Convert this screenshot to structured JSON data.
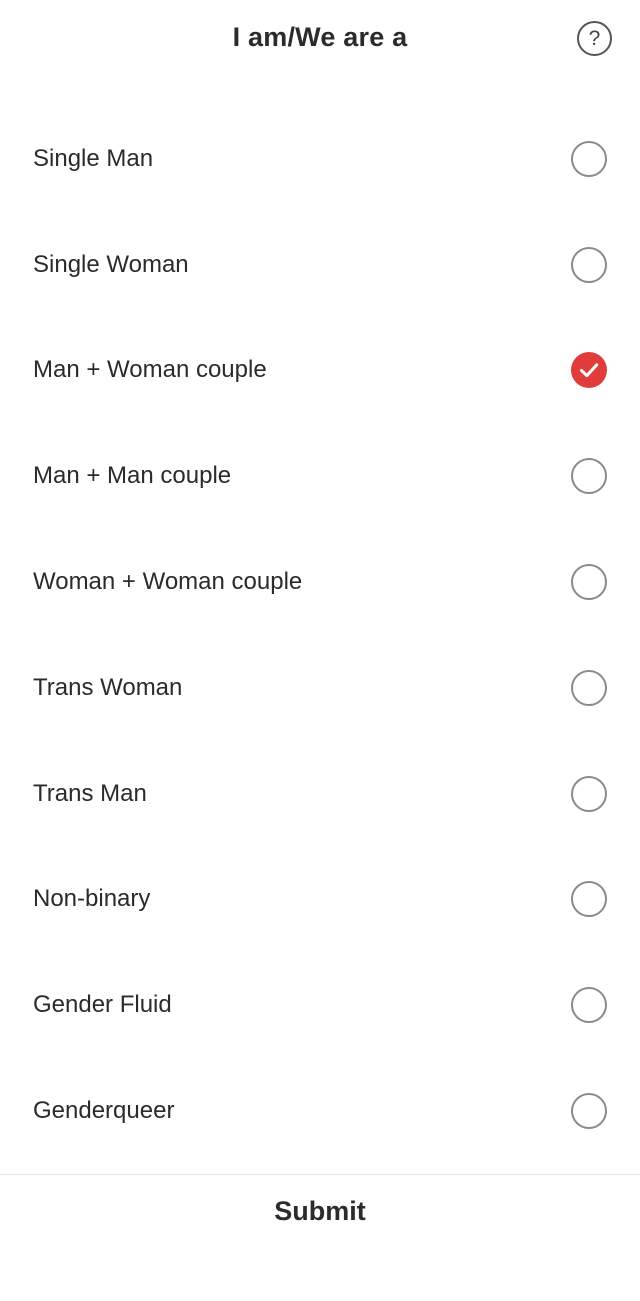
{
  "header": {
    "title": "I am/We are a",
    "help_label": "?"
  },
  "options": [
    {
      "label": "Single Man",
      "checked": false
    },
    {
      "label": "Single Woman",
      "checked": false
    },
    {
      "label": "Man + Woman couple",
      "checked": true
    },
    {
      "label": "Man + Man couple",
      "checked": false
    },
    {
      "label": "Woman + Woman couple",
      "checked": false
    },
    {
      "label": "Trans Woman",
      "checked": false
    },
    {
      "label": "Trans Man",
      "checked": false
    },
    {
      "label": "Non-binary",
      "checked": false
    },
    {
      "label": "Gender Fluid",
      "checked": false
    },
    {
      "label": "Genderqueer",
      "checked": false
    }
  ],
  "footer": {
    "submit_label": "Submit"
  },
  "colors": {
    "accent": "#e03c3c",
    "text": "#2b2b2b",
    "radio_border": "#8a8a8a"
  }
}
